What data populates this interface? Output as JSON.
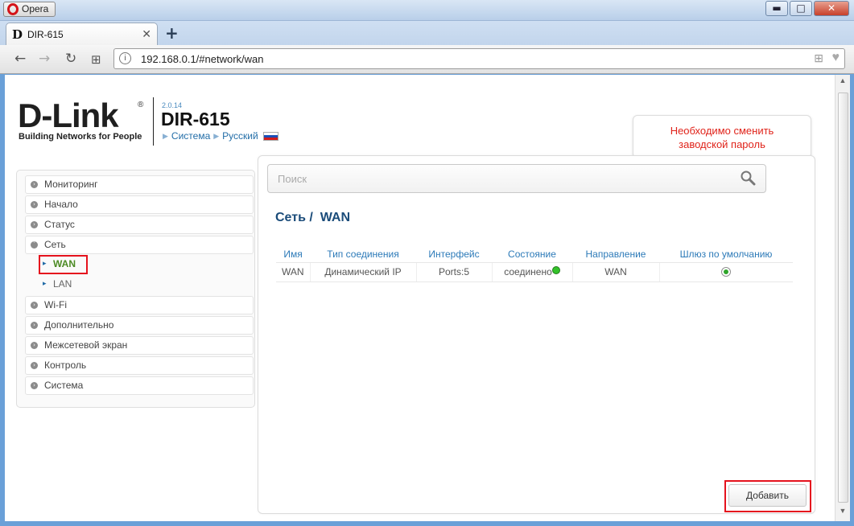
{
  "browser": {
    "app_name": "Opera",
    "window_controls": {
      "minimize": "▬",
      "maximize": "□",
      "close": "✕"
    },
    "tab": {
      "favicon": "D",
      "title": "DIR-615",
      "close": "✕"
    },
    "new_tab": "+",
    "nav": {
      "back": "←",
      "forward": "→",
      "reload": "↻",
      "speed_dial": "⊞"
    },
    "address": "192.168.0.1/#network/wan",
    "address_icons": {
      "site_info": "globe-icon",
      "speed_dial": "grid-icon",
      "bookmark": "heart-icon"
    }
  },
  "header": {
    "logo_text": "D-Link",
    "logo_reg": "®",
    "logo_tagline": "Building Networks for People",
    "firmware_version": "2.0.14",
    "model": "DIR-615",
    "breadcrumb": [
      "Система",
      "Русский"
    ]
  },
  "notice": {
    "message_line1": "Необходимо сменить",
    "message_line2": "заводской пароль",
    "count": "1"
  },
  "menu": {
    "items": [
      {
        "label": "Мониторинг",
        "expanded": false
      },
      {
        "label": "Начало",
        "expanded": false
      },
      {
        "label": "Статус",
        "expanded": false
      },
      {
        "label": "Сеть",
        "expanded": true
      },
      {
        "label": "Wi-Fi",
        "expanded": false
      },
      {
        "label": "Дополнительно",
        "expanded": false
      },
      {
        "label": "Межсетевой экран",
        "expanded": false
      },
      {
        "label": "Контроль",
        "expanded": false
      },
      {
        "label": "Система",
        "expanded": false
      }
    ],
    "sub_items": [
      {
        "label": "WAN",
        "active": true
      },
      {
        "label": "LAN",
        "active": false
      }
    ]
  },
  "search": {
    "placeholder": "Поиск",
    "value": ""
  },
  "main": {
    "title_section": "Сеть /",
    "title_page": "WAN",
    "table": {
      "headers": [
        "Имя",
        "Тип соединения",
        "Интерфейс",
        "Состояние",
        "Направление",
        "Шлюз по умолчанию"
      ],
      "rows": [
        {
          "name": "WAN",
          "type": "Динамический IP",
          "interface": "Ports:5",
          "status": "соединено",
          "direction": "WAN",
          "default_gateway": true
        }
      ]
    },
    "add_button": "Добавить"
  },
  "colors": {
    "accent_link": "#236ea8",
    "notice_red": "#e0231a",
    "active_green": "#4b8a23",
    "status_ok": "#34c22a"
  }
}
